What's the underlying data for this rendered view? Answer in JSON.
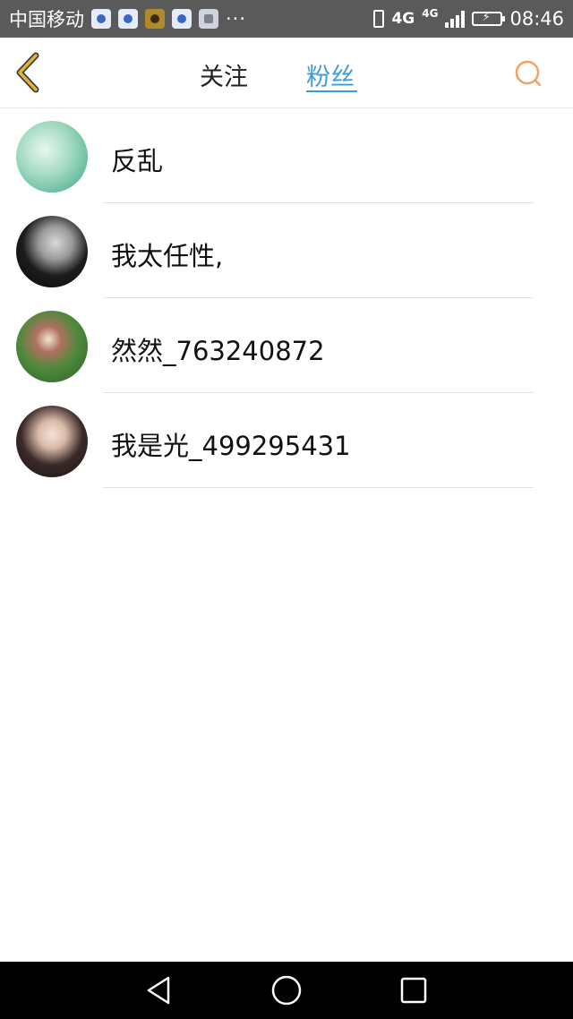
{
  "status_bar": {
    "carrier": "中国移动",
    "more": "···",
    "network": "4G",
    "network_small": "4G",
    "time": "08:46",
    "icons": [
      "paw-icon",
      "paw-icon",
      "game-icon",
      "paw-icon",
      "image-icon",
      "vibrate-icon",
      "signal-icon",
      "battery-charging-icon"
    ]
  },
  "header": {
    "back_icon": "chevron-left-icon",
    "tabs": [
      {
        "label": "关注",
        "active": false
      },
      {
        "label": "粉丝",
        "active": true
      }
    ],
    "search_icon": "search-icon",
    "accent_color": "#3c9bdc",
    "back_color": "#e0b43a",
    "search_color": "#f2a25c"
  },
  "fans": [
    {
      "name": "反乱"
    },
    {
      "name": "我太任性,"
    },
    {
      "name": "然然_763240872"
    },
    {
      "name": "我是光_499295431"
    }
  ],
  "nav_bar": {
    "icons": [
      "back-triangle-icon",
      "home-circle-icon",
      "recent-square-icon"
    ]
  }
}
